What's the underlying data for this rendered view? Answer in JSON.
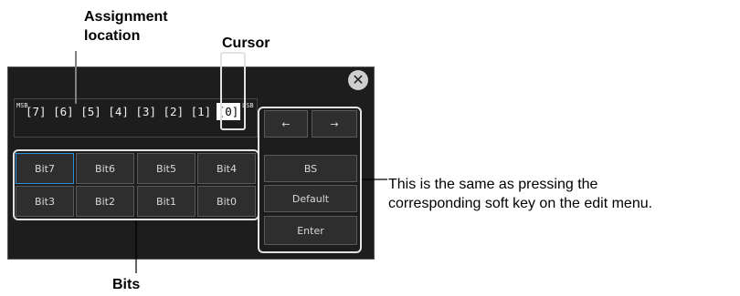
{
  "annotations": {
    "assignment_location": [
      "Assignment",
      "location"
    ],
    "cursor": "Cursor",
    "bits": "Bits",
    "soft_key_note": [
      "This is the same as pressing the",
      "corresponding soft key on the edit menu."
    ]
  },
  "dialog": {
    "msb_label": "MSB",
    "lsb_label": "LSB",
    "bit_sequence": "[7] [6] [5] [4] [3] [2] [1] ",
    "cursor_text": "[0]",
    "bit_buttons": [
      "Bit7",
      "Bit6",
      "Bit5",
      "Bit4",
      "Bit3",
      "Bit2",
      "Bit1",
      "Bit0"
    ],
    "left_arrow": "←",
    "right_arrow": "→",
    "bs_label": "BS",
    "default_label": "Default",
    "enter_label": "Enter",
    "close_glyph": "✕"
  },
  "colors": {
    "dialog_bg": "#1d1d1d",
    "button_bg": "#2e2e2e",
    "selected_border": "#2d8fd8",
    "frame": "#e2e2e2"
  }
}
